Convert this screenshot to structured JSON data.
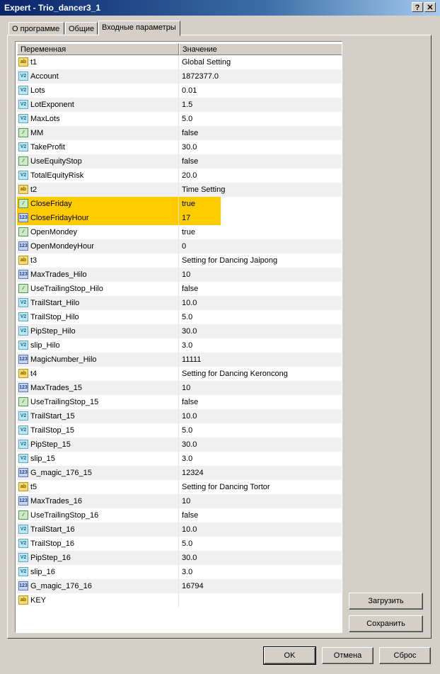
{
  "window": {
    "title": "Expert - Trio_dancer3_1",
    "help_label": "?",
    "close_label": "✕"
  },
  "tabs": [
    "О программе",
    "Общие",
    "Входные параметры"
  ],
  "table": {
    "col_variable": "Переменная",
    "col_value": "Значение",
    "rows": [
      {
        "type": "string",
        "icon": "ab",
        "name": "t1",
        "value": "Global Setting"
      },
      {
        "type": "double",
        "icon": "V2",
        "name": "Account",
        "value": "1872377.0"
      },
      {
        "type": "double",
        "icon": "V2",
        "name": "Lots",
        "value": "0.01"
      },
      {
        "type": "double",
        "icon": "V2",
        "name": "LotExponent",
        "value": "1.5"
      },
      {
        "type": "double",
        "icon": "V2",
        "name": "MaxLots",
        "value": "5.0"
      },
      {
        "type": "bool",
        "icon": "⁄",
        "name": "MM",
        "value": "false"
      },
      {
        "type": "double",
        "icon": "V2",
        "name": "TakeProfit",
        "value": "30.0"
      },
      {
        "type": "bool",
        "icon": "⁄",
        "name": "UseEquityStop",
        "value": "false"
      },
      {
        "type": "double",
        "icon": "V2",
        "name": "TotalEquityRisk",
        "value": "20.0"
      },
      {
        "type": "string",
        "icon": "ab",
        "name": "t2",
        "value": "Time Setting"
      },
      {
        "type": "bool",
        "icon": "⁄",
        "name": "CloseFriday",
        "value": "true",
        "highlight": true
      },
      {
        "type": "int",
        "icon": "123",
        "name": "CloseFridayHour",
        "value": "17",
        "highlight": true
      },
      {
        "type": "bool",
        "icon": "⁄",
        "name": "OpenMondey",
        "value": "true"
      },
      {
        "type": "int",
        "icon": "123",
        "name": "OpenMondeyHour",
        "value": "0"
      },
      {
        "type": "string",
        "icon": "ab",
        "name": "t3",
        "value": "Setting for Dancing Jaipong"
      },
      {
        "type": "int",
        "icon": "123",
        "name": "MaxTrades_Hilo",
        "value": "10"
      },
      {
        "type": "bool",
        "icon": "⁄",
        "name": "UseTrailingStop_Hilo",
        "value": "false"
      },
      {
        "type": "double",
        "icon": "V2",
        "name": "TrailStart_Hilo",
        "value": "10.0"
      },
      {
        "type": "double",
        "icon": "V2",
        "name": "TrailStop_Hilo",
        "value": "5.0"
      },
      {
        "type": "double",
        "icon": "V2",
        "name": "PipStep_Hilo",
        "value": "30.0"
      },
      {
        "type": "double",
        "icon": "V2",
        "name": "slip_Hilo",
        "value": "3.0"
      },
      {
        "type": "int",
        "icon": "123",
        "name": "MagicNumber_Hilo",
        "value": "11111"
      },
      {
        "type": "string",
        "icon": "ab",
        "name": "t4",
        "value": "Setting for Dancing Keroncong"
      },
      {
        "type": "int",
        "icon": "123",
        "name": "MaxTrades_15",
        "value": "10"
      },
      {
        "type": "bool",
        "icon": "⁄",
        "name": "UseTrailingStop_15",
        "value": "false"
      },
      {
        "type": "double",
        "icon": "V2",
        "name": "TrailStart_15",
        "value": "10.0"
      },
      {
        "type": "double",
        "icon": "V2",
        "name": "TrailStop_15",
        "value": "5.0"
      },
      {
        "type": "double",
        "icon": "V2",
        "name": "PipStep_15",
        "value": "30.0"
      },
      {
        "type": "double",
        "icon": "V2",
        "name": "slip_15",
        "value": "3.0"
      },
      {
        "type": "int",
        "icon": "123",
        "name": "G_magic_176_15",
        "value": "12324"
      },
      {
        "type": "string",
        "icon": "ab",
        "name": "t5",
        "value": "Setting for Dancing Tortor"
      },
      {
        "type": "int",
        "icon": "123",
        "name": "MaxTrades_16",
        "value": "10"
      },
      {
        "type": "bool",
        "icon": "⁄",
        "name": "UseTrailingStop_16",
        "value": "false"
      },
      {
        "type": "double",
        "icon": "V2",
        "name": "TrailStart_16",
        "value": "10.0"
      },
      {
        "type": "double",
        "icon": "V2",
        "name": "TrailStop_16",
        "value": "5.0"
      },
      {
        "type": "double",
        "icon": "V2",
        "name": "PipStep_16",
        "value": "30.0"
      },
      {
        "type": "double",
        "icon": "V2",
        "name": "slip_16",
        "value": "3.0"
      },
      {
        "type": "int",
        "icon": "123",
        "name": "G_magic_176_16",
        "value": "16794"
      },
      {
        "type": "string",
        "icon": "ab",
        "name": "KEY",
        "value": ""
      }
    ]
  },
  "buttons": {
    "load": "Загрузить",
    "save": "Сохранить",
    "ok": "OK",
    "cancel": "Отмена",
    "reset": "Сброс"
  },
  "colors": {
    "highlight": "#ffcc00",
    "titlebar": "#0a246a"
  }
}
